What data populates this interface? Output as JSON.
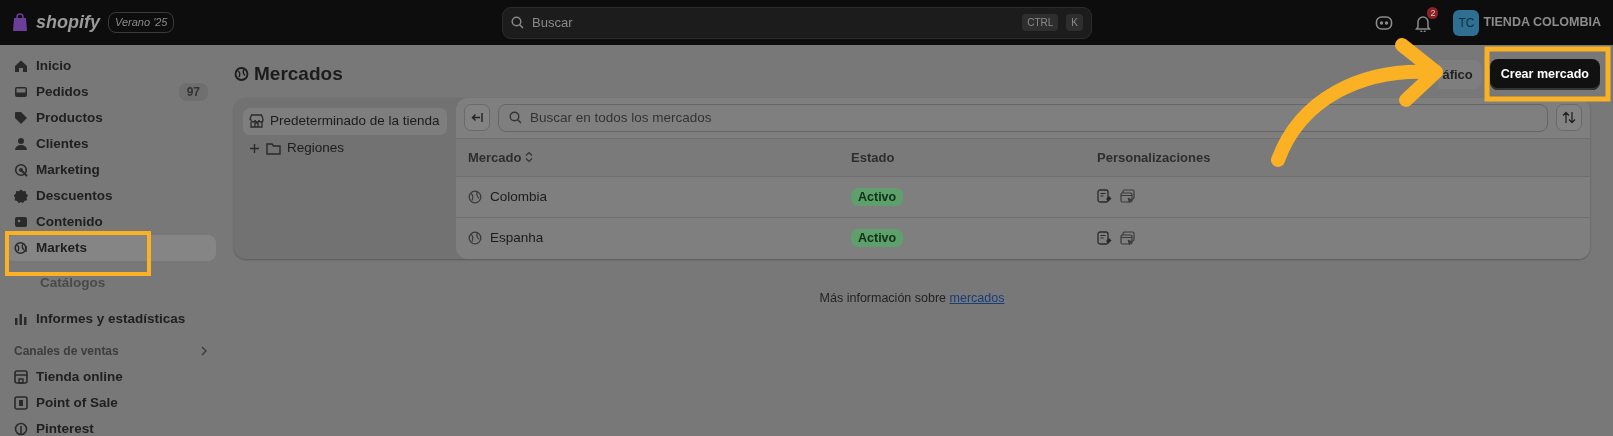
{
  "topbar": {
    "brand": "shopify",
    "edition": "Verano '25",
    "search": {
      "placeholder": "Buscar",
      "shortcut": [
        "CTRL",
        "K"
      ]
    },
    "notifications": "2",
    "avatar_initials": "TC",
    "store_name": "TIENDA COLOMBIA"
  },
  "sidebar": {
    "items": [
      {
        "label": "Inicio",
        "selected": false
      },
      {
        "label": "Pedidos",
        "badge": "97",
        "selected": false
      },
      {
        "label": "Productos",
        "selected": false
      },
      {
        "label": "Clientes",
        "selected": false
      },
      {
        "label": "Marketing",
        "selected": false
      },
      {
        "label": "Descuentos",
        "selected": false
      },
      {
        "label": "Contenido",
        "selected": false
      },
      {
        "label": "Markets",
        "selected": true
      },
      {
        "label": "Catálogos",
        "selected": false,
        "kind": "sub"
      },
      {
        "label": "Informes y estadísticas",
        "selected": false,
        "kind": "spaced"
      }
    ],
    "section": {
      "title": "Canales de ventas"
    },
    "channels": [
      {
        "label": "Tienda online"
      },
      {
        "label": "Point of Sale"
      },
      {
        "label": "Pinterest"
      }
    ]
  },
  "page": {
    "title": "Mercados",
    "secondary_button": "áfico",
    "primary_button": "Crear mercado"
  },
  "tree": [
    {
      "label": "Predeterminado de la tienda",
      "selected": true
    },
    {
      "label": "Regiones",
      "selected": false
    }
  ],
  "table": {
    "search_placeholder": "Buscar en todos los mercados",
    "columns": [
      "Mercado",
      "Estado",
      "Personalizaciones"
    ],
    "rows": [
      {
        "name": "Colombia",
        "status": "Activo"
      },
      {
        "name": "Espanha",
        "status": "Activo"
      }
    ]
  },
  "footer": {
    "text": "Más información sobre",
    "link": "mercados"
  }
}
